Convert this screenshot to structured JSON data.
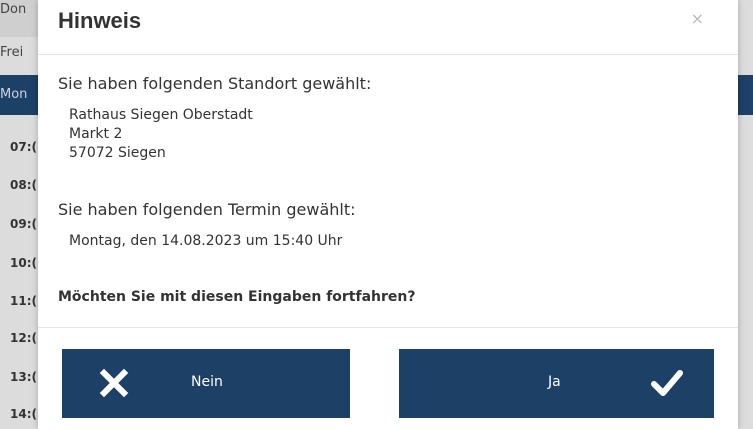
{
  "background": {
    "tab_top": "Don",
    "tab_second": "Frei",
    "header_day": "Mon",
    "times": [
      "07:(",
      "08:(",
      "09:(",
      "10:(",
      "11:(",
      "12:(",
      "13:(",
      "14:("
    ]
  },
  "modal": {
    "title": "Hinweis",
    "close_symbol": "×",
    "location_heading": "Sie haben folgenden Standort gewählt:",
    "location_lines": [
      "Rathaus Siegen Oberstadt",
      "Markt 2",
      "57072 Siegen"
    ],
    "appointment_heading": "Sie haben folgenden Termin gewählt:",
    "appointment": "Montag, den 14.08.2023 um 15:40 Uhr",
    "question": "Möchten Sie mit diesen Eingaben fortfahren?",
    "no_button": {
      "label": "Nein",
      "icon": "x-icon"
    },
    "yes_button": {
      "label": "Ja",
      "icon": "checkmark-icon"
    }
  },
  "colors": {
    "primary": "#1d4067",
    "button_text": "#ffffff",
    "text": "#333333"
  }
}
